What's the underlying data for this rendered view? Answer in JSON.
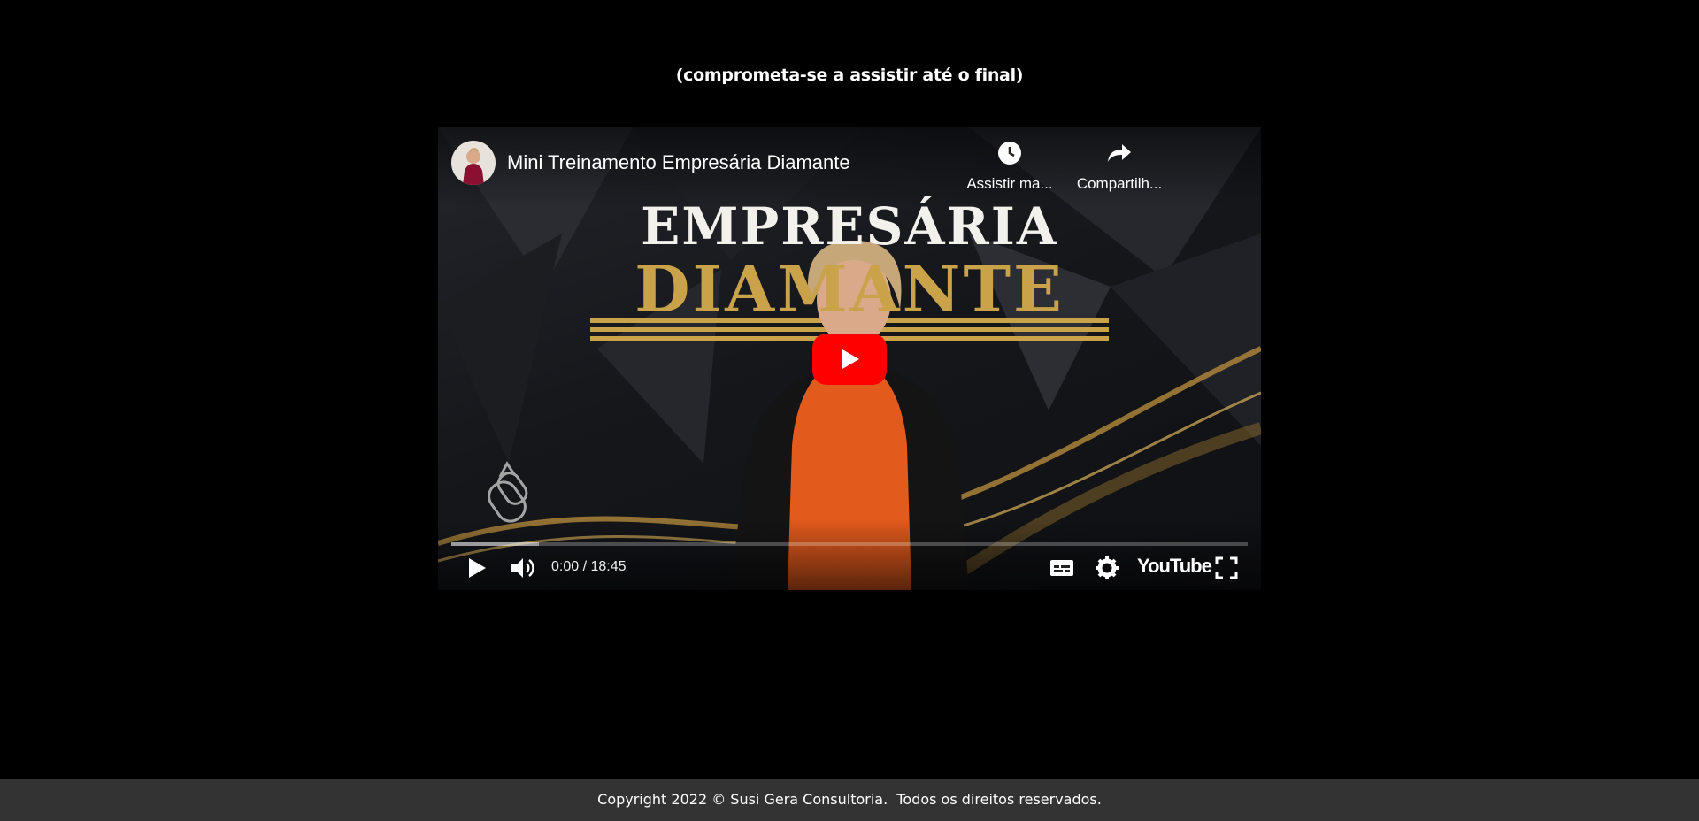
{
  "page": {
    "subtitle": "(comprometa-se a assistir até o final)",
    "footer": "Copyright 2022 © Susi Gera Consultoria.  Todos os direitos reservados."
  },
  "player": {
    "title": "Mini Treinamento Empresária Diamante",
    "watch_later_label": "Assistir ma...",
    "share_label": "Compartilh...",
    "thumbnail_headline_1": "EMPRESÁRIA",
    "thumbnail_headline_2": "DIAMANTE",
    "time_display": "0:00 / 18:45",
    "brand_logo": "YouTube",
    "buffered_fraction": 0.11,
    "icons": {
      "watch_later": "clock-icon",
      "share": "share-icon",
      "play": "play-icon",
      "volume": "volume-icon",
      "subtitles": "subtitles-icon",
      "settings": "gear-icon",
      "fullscreen": "fullscreen-icon",
      "big_play": "big-play-icon",
      "watermark": "watermark-icon"
    },
    "colors": {
      "play_button": "#ff0000",
      "gold": "#c9a24a",
      "blouse": "#e25a1c",
      "footer_bg": "#333333"
    }
  }
}
